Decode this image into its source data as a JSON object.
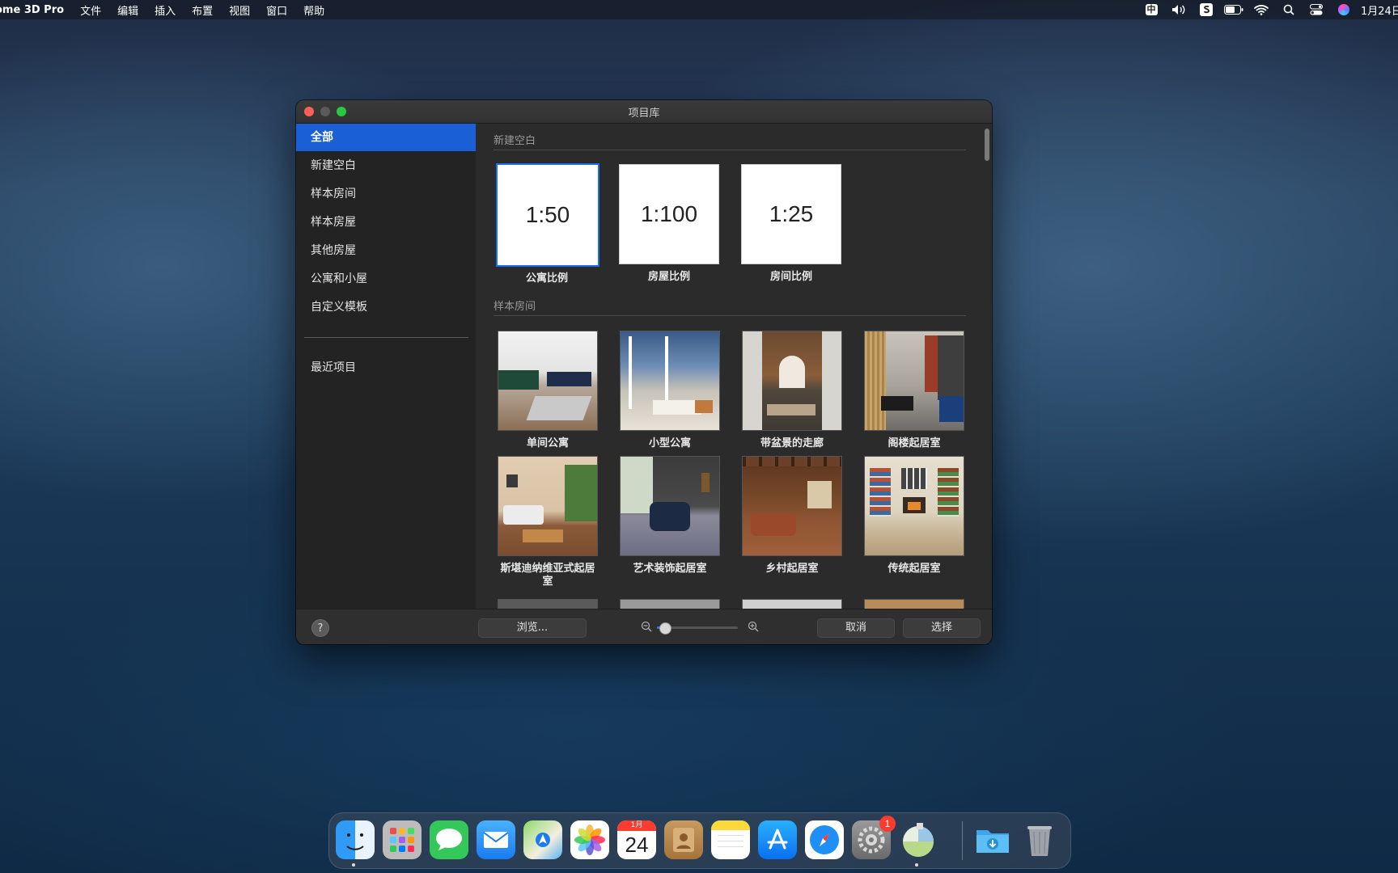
{
  "menubar": {
    "app_name": "ome 3D Pro",
    "menus": [
      "文件",
      "编辑",
      "插入",
      "布置",
      "视图",
      "窗口",
      "帮助"
    ],
    "input_method": "中",
    "clock": "1月24日"
  },
  "window": {
    "title": "项目库"
  },
  "sidebar": {
    "items": [
      "全部",
      "新建空白",
      "样本房间",
      "样本房屋",
      "其他房屋",
      "公寓和小屋",
      "自定义模板"
    ],
    "recent": "最近项目",
    "selected": "全部"
  },
  "sections": {
    "blank": {
      "header": "新建空白",
      "cards": [
        {
          "scale": "1:50",
          "label": "公寓比例",
          "selected": true
        },
        {
          "scale": "1:100",
          "label": "房屋比例",
          "selected": false
        },
        {
          "scale": "1:25",
          "label": "房间比例",
          "selected": false
        }
      ]
    },
    "rooms": {
      "header": "样本房间",
      "cards": [
        {
          "label": "单间公寓"
        },
        {
          "label": "小型公寓"
        },
        {
          "label": "带盆景的走廊"
        },
        {
          "label": "阁楼起居室"
        },
        {
          "label": "斯堪迪纳维亚式起居室"
        },
        {
          "label": "艺术装饰起居室"
        },
        {
          "label": "乡村起居室"
        },
        {
          "label": "传统起居室"
        }
      ]
    }
  },
  "footer": {
    "help": "?",
    "browse": "浏览...",
    "cancel": "取消",
    "select": "选择",
    "zoom_level": 0.1
  },
  "dock": {
    "calendar_month": "1月",
    "calendar_day": "24",
    "settings_badge": "1"
  },
  "colors": {
    "accent": "#1b5fd6",
    "selection_border": "#1b6ef3"
  }
}
